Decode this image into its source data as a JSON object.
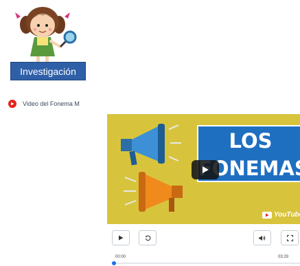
{
  "tile": {
    "label": "Investigación",
    "image": "girl-with-magnifying-glass-illustration"
  },
  "link": {
    "icon": "youtube-play-icon",
    "text": "Video del Fonema M"
  },
  "player": {
    "thumbnail": {
      "title_line1": "LOS",
      "title_line2": "FONEMAS",
      "badge": "YouTube",
      "colors": {
        "background": "#d8c43c",
        "title_box": "#1f6fc1"
      }
    },
    "controls": {
      "play": "play-icon",
      "replay": "replay-icon",
      "volume": "volume-icon",
      "fullscreen": "fullscreen-icon"
    },
    "time_current": "00:00",
    "time_total": "03:29",
    "progress": 0
  },
  "colors": {
    "accent": "#1a73e8",
    "youtube_red": "#e2231a",
    "tile_blue": "#2f5fa7"
  }
}
